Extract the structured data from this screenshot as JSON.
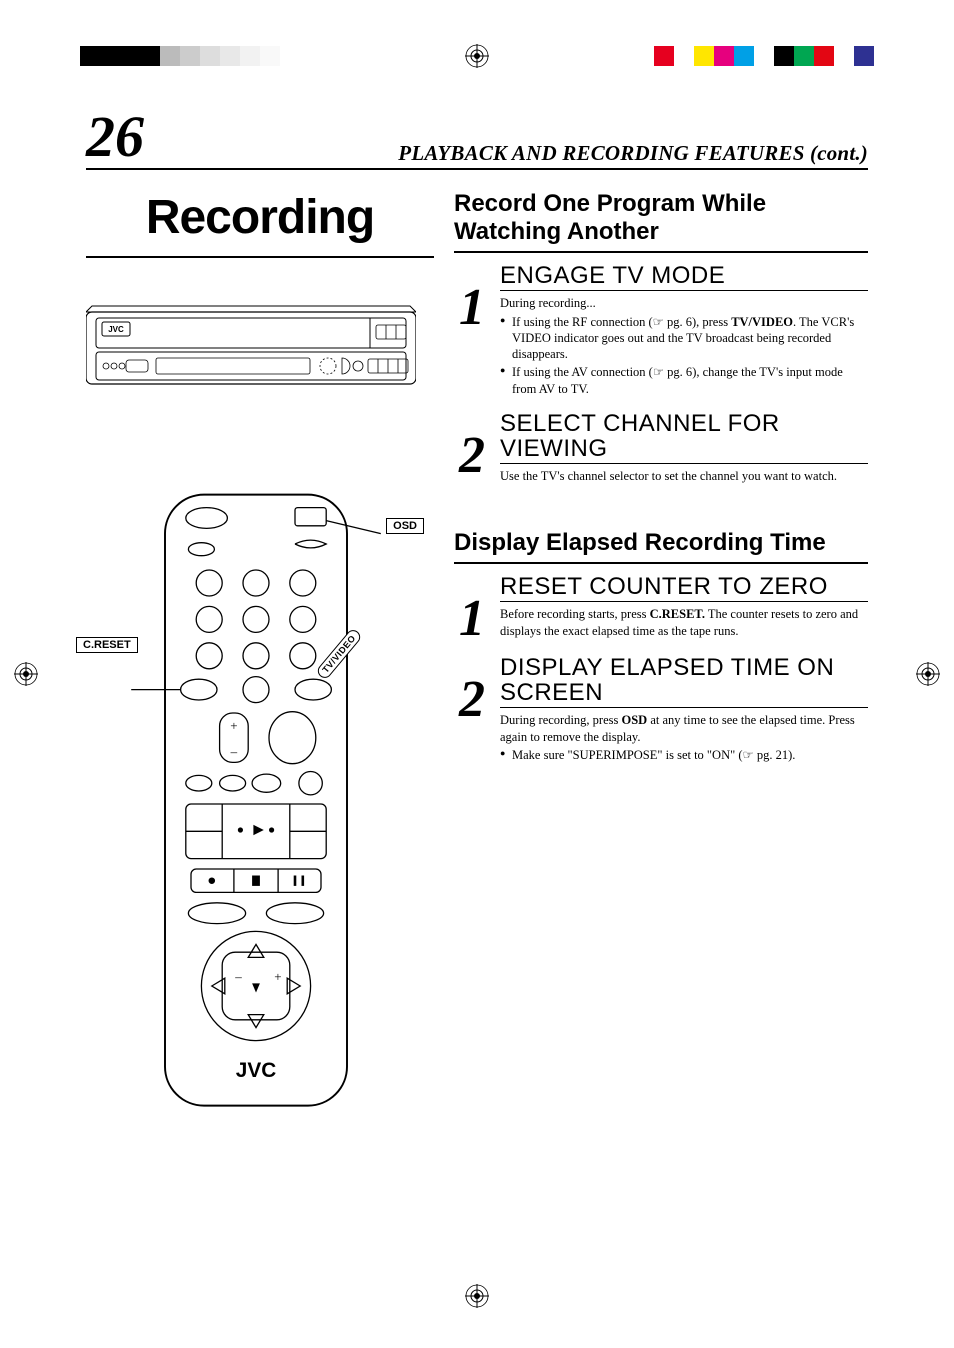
{
  "page_number": "26",
  "header_title": "PLAYBACK AND RECORDING FEATURES (cont.)",
  "main_heading": "Recording",
  "brand": "JVC",
  "sections": [
    {
      "title": "Record One Program While Watching Another",
      "steps": [
        {
          "num": "1",
          "title": "ENGAGE TV MODE",
          "intro": "During recording...",
          "bullets": [
            {
              "pre": "If using the RF connection (",
              "ref": "☞ pg. 6",
              "mid": "), press ",
              "bold": "TV/VIDEO",
              "post": ". The VCR's VIDEO indicator goes out and the TV broadcast being recorded disappears."
            },
            {
              "pre": "If using the AV connection (",
              "ref": "☞ pg. 6",
              "mid": "), change the TV's input mode from AV to TV.",
              "bold": "",
              "post": ""
            }
          ]
        },
        {
          "num": "2",
          "title": "SELECT CHANNEL FOR VIEWING",
          "body": "Use the TV's channel selector to set the channel you want to watch."
        }
      ]
    },
    {
      "title": "Display Elapsed Recording Time",
      "steps": [
        {
          "num": "1",
          "title": "RESET COUNTER TO ZERO",
          "body_parts": {
            "pre": "Before recording starts, press ",
            "bold": "C.RESET.",
            "post": " The counter resets to zero and displays the exact elapsed time as the tape runs."
          }
        },
        {
          "num": "2",
          "title": "DISPLAY ELAPSED TIME ON SCREEN",
          "body_parts": {
            "pre": "During recording, press ",
            "bold": "OSD",
            "post": " at any time to see the elapsed time. Press again to remove the display."
          },
          "bullets": [
            {
              "pre": "Make sure \"SUPERIMPOSE\" is set to \"ON\" (",
              "ref": "☞ pg. 21",
              "post": ")."
            }
          ]
        }
      ]
    }
  ],
  "callouts": {
    "osd": "OSD",
    "creset": "C.RESET",
    "tvvideo": "TV/VIDEO"
  }
}
